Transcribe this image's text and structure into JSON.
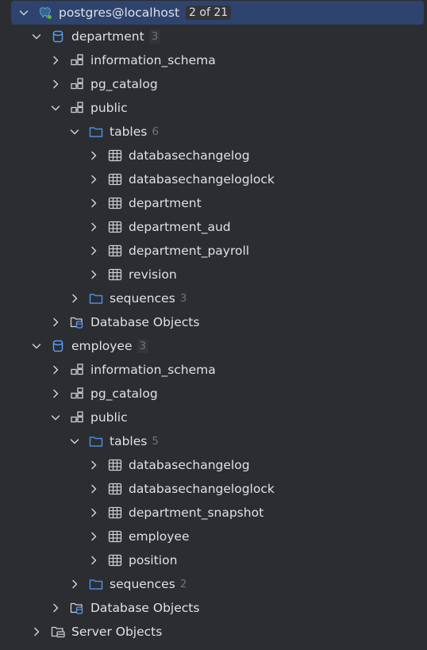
{
  "root": {
    "label": "postgres@localhost",
    "badge": "2 of 21"
  },
  "db1": {
    "label": "department",
    "count": "3",
    "schemas": [
      "information_schema",
      "pg_catalog",
      "public"
    ],
    "tables_label": "tables",
    "tables_count": "6",
    "tables": [
      "databasechangelog",
      "databasechangeloglock",
      "department",
      "department_aud",
      "department_payroll",
      "revision"
    ],
    "sequences_label": "sequences",
    "sequences_count": "3",
    "objects_label": "Database Objects"
  },
  "db2": {
    "label": "employee",
    "count": "3",
    "schemas": [
      "information_schema",
      "pg_catalog",
      "public"
    ],
    "tables_label": "tables",
    "tables_count": "5",
    "tables": [
      "databasechangelog",
      "databasechangeloglock",
      "department_snapshot",
      "employee",
      "position"
    ],
    "sequences_label": "sequences",
    "sequences_count": "2",
    "objects_label": "Database Objects"
  },
  "server_objects_label": "Server Objects",
  "colors": {
    "selection": "#2e436e",
    "folder": "#4c8dde",
    "db_icon": "#5a9cf8"
  }
}
